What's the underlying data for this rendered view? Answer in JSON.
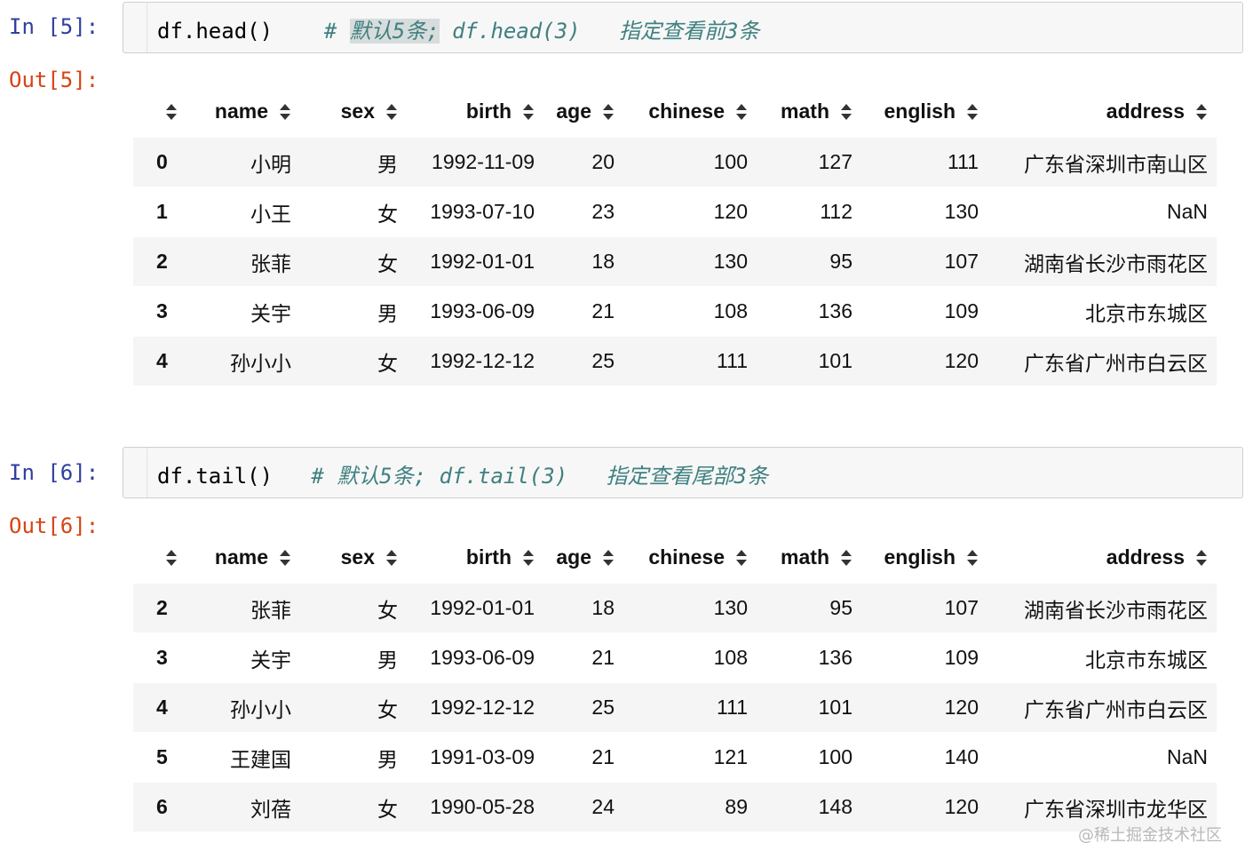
{
  "cells": [
    {
      "in_prompt": "In [5]:",
      "out_prompt": "Out[5]:",
      "code": "df.head()",
      "comment_hash": "# ",
      "comment_highlight": "默认5条;",
      "comment_rest": " df.head(3)   指定查看前3条",
      "columns": [
        "name",
        "sex",
        "birth",
        "age",
        "chinese",
        "math",
        "english",
        "address"
      ],
      "rows": [
        {
          "index": "0",
          "values": [
            "小明",
            "男",
            "1992-11-09",
            "20",
            "100",
            "127",
            "111",
            "广东省深圳市南山区"
          ]
        },
        {
          "index": "1",
          "values": [
            "小王",
            "女",
            "1993-07-10",
            "23",
            "120",
            "112",
            "130",
            "NaN"
          ]
        },
        {
          "index": "2",
          "values": [
            "张菲",
            "女",
            "1992-01-01",
            "18",
            "130",
            "95",
            "107",
            "湖南省长沙市雨花区"
          ]
        },
        {
          "index": "3",
          "values": [
            "关宇",
            "男",
            "1993-06-09",
            "21",
            "108",
            "136",
            "109",
            "北京市东城区"
          ]
        },
        {
          "index": "4",
          "values": [
            "孙小小",
            "女",
            "1992-12-12",
            "25",
            "111",
            "101",
            "120",
            "广东省广州市白云区"
          ]
        }
      ]
    },
    {
      "in_prompt": "In [6]:",
      "out_prompt": "Out[6]:",
      "code": "df.tail()",
      "comment_hash": "# ",
      "comment_highlight": "",
      "comment_rest": "默认5条; df.tail(3)   指定查看尾部3条",
      "columns": [
        "name",
        "sex",
        "birth",
        "age",
        "chinese",
        "math",
        "english",
        "address"
      ],
      "rows": [
        {
          "index": "2",
          "values": [
            "张菲",
            "女",
            "1992-01-01",
            "18",
            "130",
            "95",
            "107",
            "湖南省长沙市雨花区"
          ]
        },
        {
          "index": "3",
          "values": [
            "关宇",
            "男",
            "1993-06-09",
            "21",
            "108",
            "136",
            "109",
            "北京市东城区"
          ]
        },
        {
          "index": "4",
          "values": [
            "孙小小",
            "女",
            "1992-12-12",
            "25",
            "111",
            "101",
            "120",
            "广东省广州市白云区"
          ]
        },
        {
          "index": "5",
          "values": [
            "王建国",
            "男",
            "1991-03-09",
            "21",
            "121",
            "100",
            "140",
            "NaN"
          ]
        },
        {
          "index": "6",
          "values": [
            "刘蓓",
            "女",
            "1990-05-28",
            "24",
            "89",
            "148",
            "120",
            "广东省深圳市龙华区"
          ]
        }
      ]
    }
  ],
  "watermark": "@稀土掘金技术社区",
  "colors": {
    "in_prompt": "#303f9f",
    "out_prompt": "#d84315",
    "comment": "#408080",
    "input_bg": "#f7f7f7",
    "row_stripe": "#f5f5f5"
  },
  "icons": [
    "sort-arrows-icon"
  ]
}
